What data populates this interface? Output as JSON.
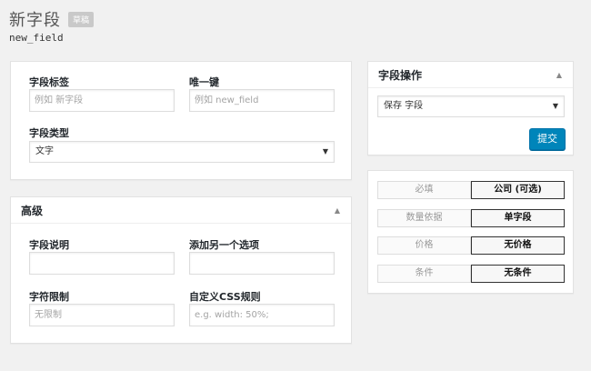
{
  "header": {
    "title": "新字段",
    "badge": "草稿",
    "slug": "new_field"
  },
  "main_panel": {
    "field_label": {
      "label": "字段标签",
      "placeholder": "例如 新字段"
    },
    "unique_key": {
      "label": "唯一键",
      "placeholder": "例如 new_field"
    },
    "field_type": {
      "label": "字段类型",
      "value": "文字"
    }
  },
  "advanced_panel": {
    "title": "高级",
    "description": {
      "label": "字段说明",
      "placeholder": ""
    },
    "add_option": {
      "label": "添加另一个选项",
      "placeholder": ""
    },
    "char_limit": {
      "label": "字符限制",
      "placeholder": "无限制"
    },
    "custom_css": {
      "label": "自定义CSS规则",
      "placeholder": "e.g. width: 50%;"
    }
  },
  "actions_panel": {
    "title": "字段操作",
    "select_value": "保存 字段",
    "submit_label": "提交"
  },
  "summary_panel": {
    "rows": [
      {
        "key": "必填",
        "value": "公司 (可选)"
      },
      {
        "key": "数量依据",
        "value": "单字段"
      },
      {
        "key": "价格",
        "value": "无价格"
      },
      {
        "key": "条件",
        "value": "无条件"
      }
    ]
  },
  "colors": {
    "primary_button": "#0085ba",
    "background": "#f1f1f1"
  },
  "icons": {
    "collapse": "triangle-up-icon",
    "dropdown": "triangle-down-icon"
  }
}
